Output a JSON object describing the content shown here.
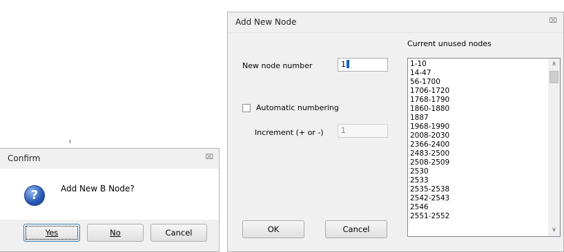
{
  "add_node_dialog": {
    "title": "Add New Node",
    "close_glyph": "⌧",
    "new_node_label": "New node number",
    "new_node_value": "1",
    "auto_numbering_label": "Automatic numbering",
    "auto_numbering_checked": false,
    "increment_label": "Increment (+ or -)",
    "increment_value": "1",
    "unused_nodes_label": "Current unused nodes",
    "unused_nodes": [
      "1-10",
      "14-47",
      "56-1700",
      "1706-1720",
      "1768-1790",
      "1860-1880",
      "1887",
      "1968-1990",
      "2008-2030",
      "2366-2400",
      "2483-2500",
      "2508-2509",
      "2530",
      "2533",
      "2535-2538",
      "2542-2543",
      "2546",
      "2551-2552"
    ],
    "ok_label": "OK",
    "cancel_label": "Cancel"
  },
  "confirm_dialog": {
    "title": "Confirm",
    "close_glyph": "⌧",
    "message": "Add New B Node?",
    "icon_glyph": "?",
    "yes_label": "Yes",
    "no_label": "No",
    "cancel_label": "Cancel"
  }
}
